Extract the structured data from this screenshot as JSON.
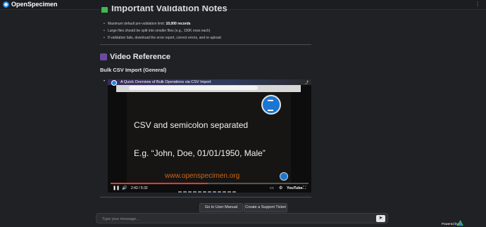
{
  "app": {
    "name": "OpenSpecimen"
  },
  "notes": {
    "heading_partial": "Important Validation Notes",
    "items": [
      {
        "prefix": "Maximum default pre-validation limit: ",
        "strong": "10,000 records"
      },
      {
        "prefix": "Large files should be split into smaller files (e.g., 100K rows each)",
        "strong": ""
      },
      {
        "prefix": "If validation fails, download the error report, correct errors, and re-upload",
        "strong": ""
      }
    ]
  },
  "video_section": {
    "title": "Video Reference",
    "subtitle": "Bulk CSV Import (General)",
    "video": {
      "title": "A Quick Overview of Bulk Operations via CSV Import",
      "slide_line1": "CSV and semicolon separated",
      "slide_line2": "E.g. “John, Doe, 01/01/1950, Male”",
      "slide_url": "www.openspecimen.org",
      "time": "2:42 / 5:32",
      "progress_fraction": 0.49,
      "brand": "YouTube",
      "share_label": "Share"
    }
  },
  "actions": {
    "manual_label": "Go to User Manual",
    "ticket_label": "Create a Support Ticket"
  },
  "chat": {
    "placeholder": "Type your message..."
  },
  "footer": {
    "powered_by": "Powered by"
  },
  "colors": {
    "background": "#1f2125",
    "accent_red": "#e53935",
    "slide_url": "#c8671e"
  }
}
